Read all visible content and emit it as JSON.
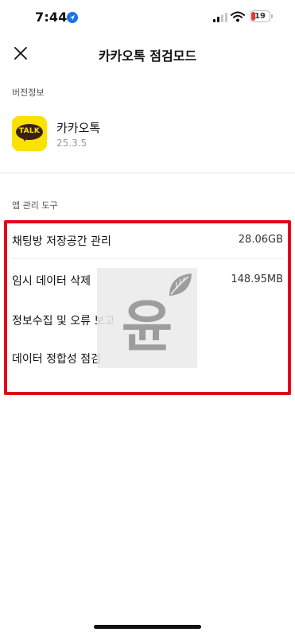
{
  "status_bar": {
    "time": "7:44",
    "battery_level": "19",
    "battery_color": "#e53935"
  },
  "nav": {
    "title": "카카오톡 점검모드",
    "close_icon": "close-icon"
  },
  "version_section": {
    "label": "버전정보",
    "app_name": "카카오톡",
    "app_version": "25.3.5",
    "app_icon_text": "TALK",
    "app_icon_color": "#fae100"
  },
  "tools_section": {
    "label": "앱 관리 도구",
    "items": [
      {
        "label": "채팅방 저장공간 관리",
        "value": "28.06GB"
      },
      {
        "label": "임시 데이터 삭제",
        "value": "148.95MB"
      },
      {
        "label": "정보수집 및 오류 보고",
        "value": ""
      },
      {
        "label": "데이터 정합성 점검",
        "value": ""
      }
    ]
  },
  "watermark": {
    "text": "윤"
  },
  "highlight_color": "#e5001c"
}
